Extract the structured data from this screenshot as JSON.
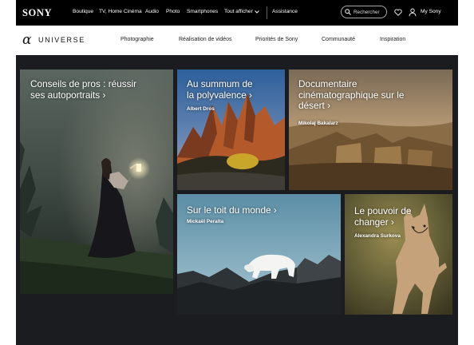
{
  "header": {
    "brand": "SONY",
    "nav": [
      "Boutique",
      "TV, Home Cinéma",
      "Audio",
      "Photo",
      "Smartphones",
      "Tout afficher",
      "Assistance"
    ],
    "search_placeholder": "Rechercher",
    "account_label": "My Sony"
  },
  "universe": {
    "alpha": "α",
    "name": "UNIVERSE",
    "nav": [
      "Photographie",
      "Réalisation de vidéos",
      "Priorités de Sony",
      "Communauté",
      "Inspiration"
    ]
  },
  "cards": [
    {
      "title_line1": "Conseils de pros : réussir",
      "title_line2": "ses autoportraits ›",
      "author": ""
    },
    {
      "title_line1": "Au summum de",
      "title_line2": "la polyvalence ›",
      "author": "Albert Dros"
    },
    {
      "title_line1": "Documentaire",
      "title_line2": "cinématographique sur le",
      "title_line3": "désert ›",
      "author": "Mikolaj Bakalarz"
    },
    {
      "title_line1": "Sur le toit du monde ›",
      "author": "Mickaël Peralta"
    },
    {
      "title_line1": "Le pouvoir de",
      "title_line2": "changer ›",
      "author": "Alexandra Surkova"
    }
  ],
  "colors": {
    "topbar": "#000000",
    "page_bg": "#1b1c20"
  }
}
